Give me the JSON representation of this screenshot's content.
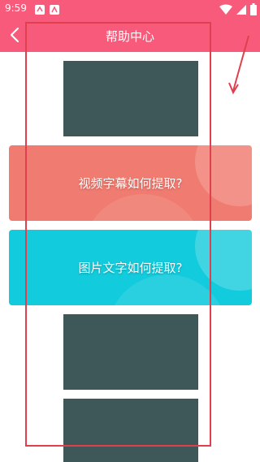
{
  "status_bar": {
    "time": "9:59"
  },
  "app_bar": {
    "title": "帮助中心"
  },
  "cards": [
    {
      "label": "视频字幕如何提取?"
    },
    {
      "label": "图片文字如何提取?"
    }
  ],
  "colors": {
    "accent": "#f75a7a",
    "card_video": "#f07b70",
    "card_image": "#12cbdc",
    "thumbnail": "#3e5759",
    "annotation": "#e0404e"
  }
}
